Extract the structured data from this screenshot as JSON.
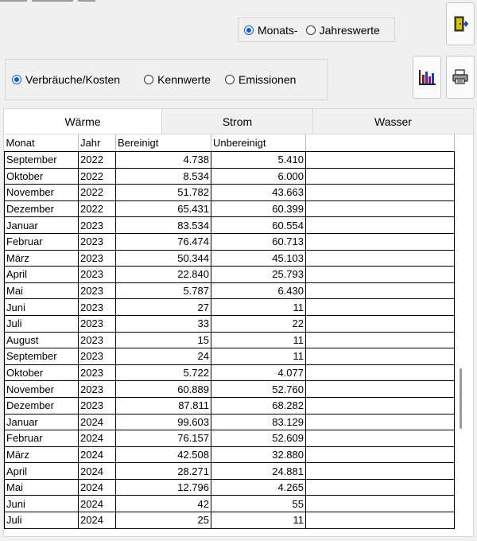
{
  "period": {
    "monthly_label": "Monats-",
    "yearly_label": "Jahreswerte",
    "selected": "monthly"
  },
  "view": {
    "options": [
      {
        "label": "Verbräuche/Kosten",
        "selected": true
      },
      {
        "label": "Kennwerte",
        "selected": false
      },
      {
        "label": "Emissionen",
        "selected": false
      }
    ]
  },
  "tabs": [
    {
      "label": "Wärme",
      "active": true
    },
    {
      "label": "Strom",
      "active": false
    },
    {
      "label": "Wasser",
      "active": false
    }
  ],
  "table": {
    "headers": [
      "Monat",
      "Jahr",
      "Bereinigt",
      "Unbereinigt"
    ],
    "rows": [
      [
        "September",
        "2022",
        "4.738",
        "5.410"
      ],
      [
        "Oktober",
        "2022",
        "8.534",
        "6.000"
      ],
      [
        "November",
        "2022",
        "51.782",
        "43.663"
      ],
      [
        "Dezember",
        "2022",
        "65.431",
        "60.399"
      ],
      [
        "Januar",
        "2023",
        "83.534",
        "60.554"
      ],
      [
        "Februar",
        "2023",
        "76.474",
        "60.713"
      ],
      [
        "März",
        "2023",
        "50.344",
        "45.103"
      ],
      [
        "April",
        "2023",
        "22.840",
        "25.793"
      ],
      [
        "Mai",
        "2023",
        "5.787",
        "6.430"
      ],
      [
        "Juni",
        "2023",
        "27",
        "11"
      ],
      [
        "Juli",
        "2023",
        "33",
        "22"
      ],
      [
        "August",
        "2023",
        "15",
        "11"
      ],
      [
        "September",
        "2023",
        "24",
        "11"
      ],
      [
        "Oktober",
        "2023",
        "5.722",
        "4.077"
      ],
      [
        "November",
        "2023",
        "60.889",
        "52.760"
      ],
      [
        "Dezember",
        "2023",
        "87.811",
        "68.282"
      ],
      [
        "Januar",
        "2024",
        "99.603",
        "83.129"
      ],
      [
        "Februar",
        "2024",
        "76.157",
        "52.609"
      ],
      [
        "März",
        "2024",
        "42.508",
        "32.880"
      ],
      [
        "April",
        "2024",
        "28.271",
        "24.881"
      ],
      [
        "Mai",
        "2024",
        "12.796",
        "4.265"
      ],
      [
        "Juni",
        "2024",
        "42",
        "55"
      ],
      [
        "Juli",
        "2024",
        "25",
        "11"
      ]
    ]
  },
  "icons": {
    "exit": "exit-door-icon",
    "chart": "bar-chart-icon",
    "print": "printer-icon"
  }
}
